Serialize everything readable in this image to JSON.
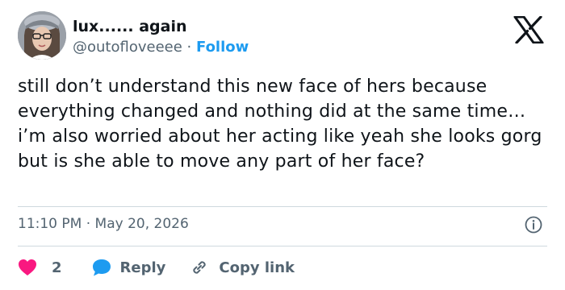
{
  "author": {
    "display_name": "lux...... again",
    "handle": "@outofloveeee",
    "separator": "·",
    "follow_label": "Follow"
  },
  "tweet": {
    "text": "still don’t understand this new face of hers because everything changed and nothing did at the same time… i’m also worried about her acting like yeah she looks gorg but is she able to move any part of her face?",
    "timestamp": "11:10 PM · May 20, 2026"
  },
  "actions": {
    "like_count": "2",
    "reply_label": "Reply",
    "copy_link_label": "Copy link"
  },
  "icons": {
    "brand": "x-logo-icon",
    "info": "info-icon",
    "like": "heart-icon",
    "reply": "speech-bubble-icon",
    "copy": "link-icon"
  },
  "colors": {
    "text": "#0f1419",
    "secondary": "#536471",
    "accent": "#1d9bf0",
    "like": "#f91880",
    "divider": "#cfd9de"
  }
}
